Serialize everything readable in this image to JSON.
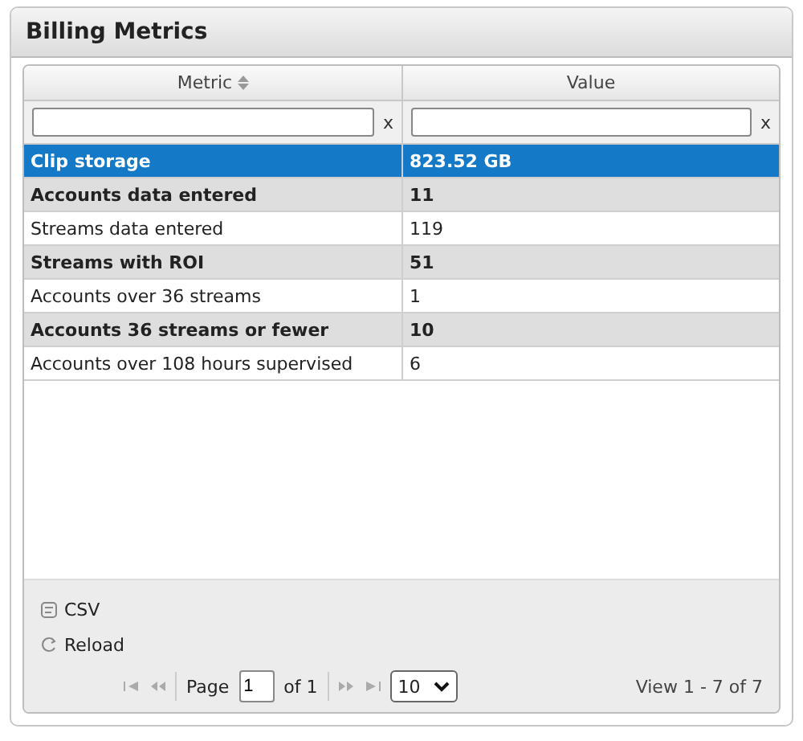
{
  "panel": {
    "title": "Billing Metrics"
  },
  "columns": [
    {
      "label": "Metric",
      "sortable": true
    },
    {
      "label": "Value",
      "sortable": false
    }
  ],
  "filters": [
    {
      "clear": "x"
    },
    {
      "clear": "x"
    }
  ],
  "rows": [
    {
      "metric": "Clip storage",
      "value": "823.52 GB",
      "selected": true,
      "shaded": false
    },
    {
      "metric": "Accounts data entered",
      "value": "11",
      "selected": false,
      "shaded": true
    },
    {
      "metric": "Streams data entered",
      "value": "119",
      "selected": false,
      "shaded": false
    },
    {
      "metric": "Streams with ROI",
      "value": "51",
      "selected": false,
      "shaded": true
    },
    {
      "metric": "Accounts over 36 streams",
      "value": "1",
      "selected": false,
      "shaded": false
    },
    {
      "metric": "Accounts 36 streams or fewer",
      "value": "10",
      "selected": false,
      "shaded": true
    },
    {
      "metric": "Accounts over 108 hours supervised",
      "value": "6",
      "selected": false,
      "shaded": false
    }
  ],
  "actions": [
    {
      "kind": "csv",
      "label": "CSV"
    },
    {
      "kind": "reload",
      "label": "Reload"
    }
  ],
  "pager": {
    "page_label": "Page",
    "page": "1",
    "of_label": "of 1",
    "page_size": "10",
    "summary": "View 1 - 7 of 7"
  }
}
